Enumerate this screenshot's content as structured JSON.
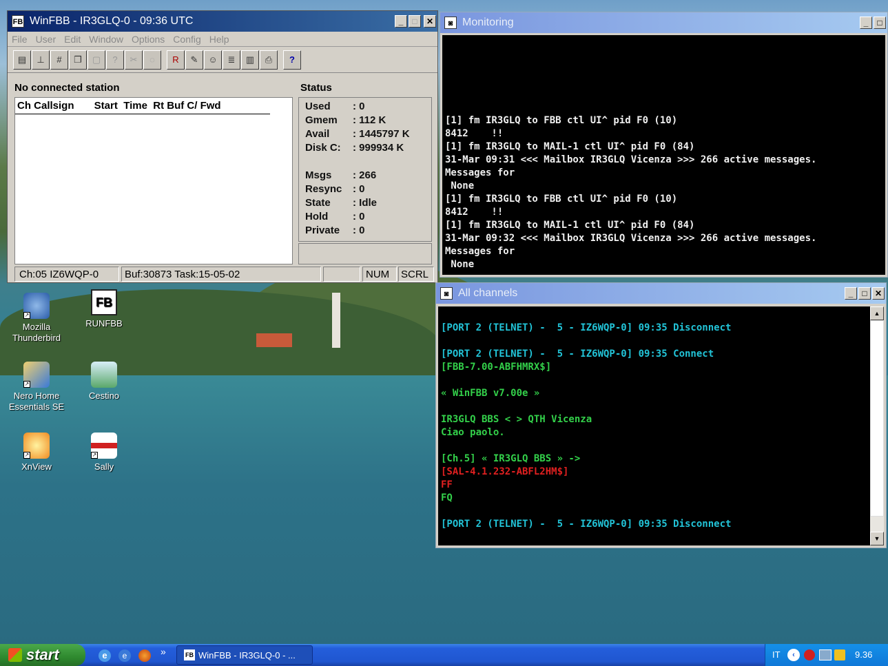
{
  "winfbb": {
    "title": "WinFBB - IR3GLQ-0 - 09:36 UTC",
    "menu": [
      "File",
      "User",
      "Edit",
      "Window",
      "Options",
      "Config",
      "Help"
    ],
    "no_connected": "No connected station",
    "columns": "Ch Callsign       Start  Time  Rt Buf C/ Fwd",
    "status_title": "Status",
    "status": [
      {
        "k": "Used",
        "v": ": 0"
      },
      {
        "k": "Gmem",
        "v": ": 112 K"
      },
      {
        "k": "Avail",
        "v": ": 1445797 K"
      },
      {
        "k": "Disk C:",
        "v": ": 999934 K"
      },
      {
        "k": "",
        "v": ""
      },
      {
        "k": "Msgs",
        "v": ": 266"
      },
      {
        "k": "Resync",
        "v": ": 0"
      },
      {
        "k": "State",
        "v": ": Idle"
      },
      {
        "k": "Hold",
        "v": ": 0"
      },
      {
        "k": "Private",
        "v": ": 0"
      }
    ],
    "statusbar": {
      "ch": "Ch:05 IZ6WQP-0",
      "buf": "Buf:30873 Task:15-05-02",
      "num": "NUM",
      "scrl": "SCRL"
    },
    "toolbar_help": "?"
  },
  "monitoring": {
    "title": "Monitoring",
    "lines": [
      "[1] fm IR3GLQ to FBB ctl UI^ pid F0 (10)",
      "8412    !!",
      "[1] fm IR3GLQ to MAIL-1 ctl UI^ pid F0 (84)",
      "31-Mar 09:31 <<< Mailbox IR3GLQ Vicenza >>> 266 active messages.",
      "Messages for",
      " None",
      "[1] fm IR3GLQ to FBB ctl UI^ pid F0 (10)",
      "8412    !!",
      "[1] fm IR3GLQ to MAIL-1 ctl UI^ pid F0 (84)",
      "31-Mar 09:32 <<< Mailbox IR3GLQ Vicenza >>> 266 active messages.",
      "Messages for",
      " None"
    ]
  },
  "allchannels": {
    "title": "All channels",
    "lines": [
      {
        "t": "[PORT 2 (TELNET) -  5 - IZ6WQP-0] 09:35 Disconnect",
        "c": "cyan"
      },
      {
        "t": "",
        "c": "cyan"
      },
      {
        "t": "[PORT 2 (TELNET) -  5 - IZ6WQP-0] 09:35 Connect",
        "c": "cyan"
      },
      {
        "t": "[FBB-7.00-ABFHMRX$]",
        "c": "green"
      },
      {
        "t": "",
        "c": "green"
      },
      {
        "t": "« WinFBB v7.00e »",
        "c": "green"
      },
      {
        "t": "",
        "c": "green"
      },
      {
        "t": "IR3GLQ BBS < > QTH Vicenza",
        "c": "green"
      },
      {
        "t": "Ciao paolo.",
        "c": "green"
      },
      {
        "t": "",
        "c": "green"
      },
      {
        "t": "[Ch.5] « IR3GLQ BBS » ->",
        "c": "green"
      },
      {
        "t": "[SAL-4.1.232-ABFL2HM$]",
        "c": "red"
      },
      {
        "t": "FF",
        "c": "red"
      },
      {
        "t": "FQ",
        "c": "green"
      },
      {
        "t": "",
        "c": "green"
      },
      {
        "t": "[PORT 2 (TELNET) -  5 - IZ6WQP-0] 09:35 Disconnect",
        "c": "cyan"
      }
    ]
  },
  "desktop_icons": [
    {
      "label": "Mozilla\nThunderbird",
      "icon": "thunderbird-icon"
    },
    {
      "label": "RUNFBB",
      "icon": "fbb-icon"
    },
    {
      "label": "Nero Home\nEssentials SE",
      "icon": "nero-icon"
    },
    {
      "label": "Cestino",
      "icon": "recycle-bin-icon"
    },
    {
      "label": "XnView",
      "icon": "xnview-icon"
    },
    {
      "label": "Sally",
      "icon": "sally-icon"
    }
  ],
  "taskbar": {
    "start": "start",
    "task": "WinFBB - IR3GLQ-0 - ...",
    "lang": "IT",
    "clock": "9.36",
    "chevron": "»"
  },
  "colors": {
    "cyan": "#22c4d8",
    "green": "#33d04a",
    "red": "#e02020",
    "term_white": "#f0f0f0"
  }
}
